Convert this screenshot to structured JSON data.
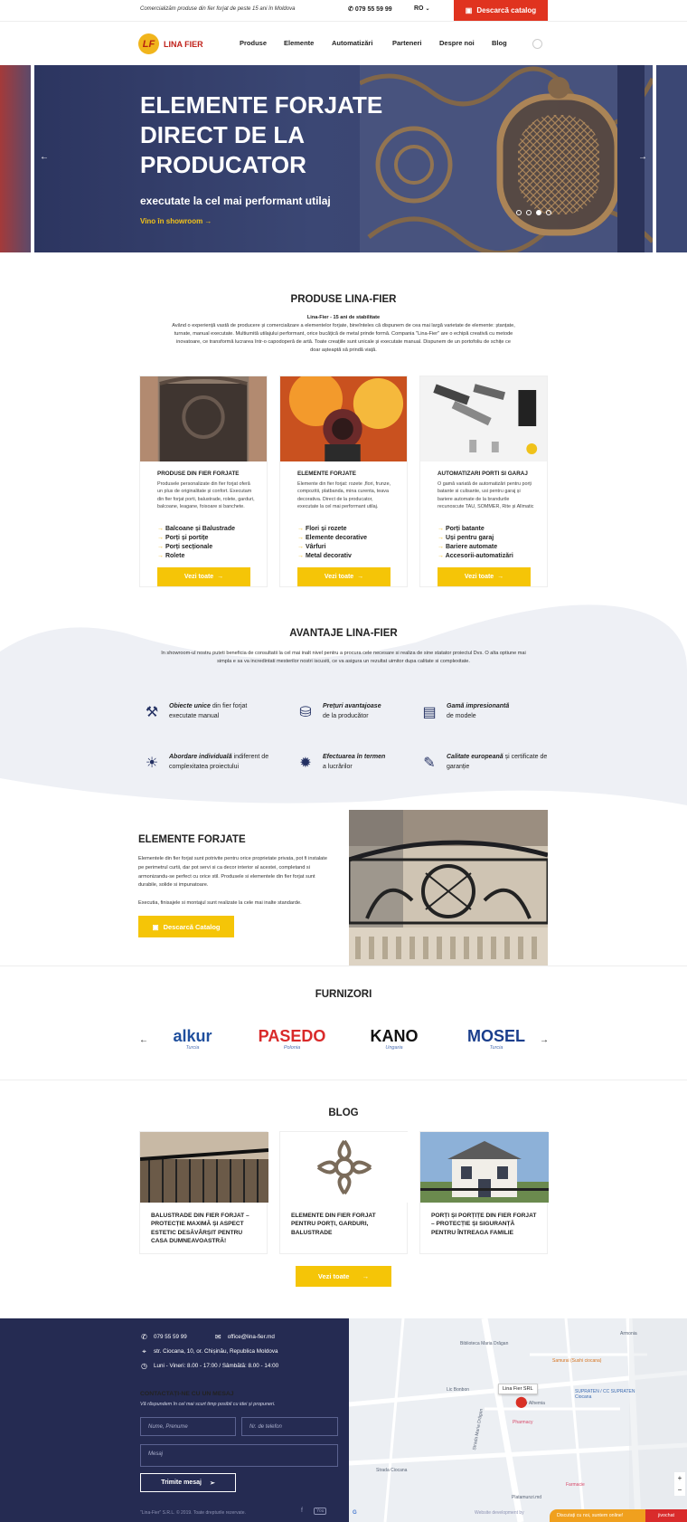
{
  "topbar": {
    "tagline": "Comercializăm produse din fier forjat de peste 15 ani în Moldova",
    "phone": "079 55 59 99",
    "lang": "RO",
    "catalog_label": "Descarcă catalog"
  },
  "header": {
    "logo_mark": "LF",
    "logo_text": "LINA FIER",
    "nav": [
      "Produse",
      "Elemente",
      "Automatizări",
      "Parteneri",
      "Despre noi",
      "Blog"
    ]
  },
  "hero": {
    "title": "ELEMENTE FORJATE DIRECT DE LA PRODUCATOR",
    "subtitle": "executate la cel mai performant utilaj",
    "cta": "Vino în showroom",
    "slides": 4,
    "active_slide": 3
  },
  "products": {
    "title": "PRODUSE LINA-FIER",
    "subtitle": "Lina-Fier - 15 ani de stabilitate",
    "intro": "Având o experiență vastă de producere și comercializare a elementelor forjate, bineînteles că dispunem de cea mai largă varietate de elemente: ștanțate, turnate, manual executate. Multiumită utilajului performant, orice bucățică de metal prinde formă. Compania \"Lina-Fier\" are o echipă creativă cu metode inovatoare, ce transformă lucrarea într-o capodoperă de artă. Toate creațiile sunt unicale și executate manual. Dispunem de un portofoliu de schițe ce doar așteaptă să prindă viață.",
    "cards": [
      {
        "title": "PRODUSE DIN FIER FORJATE",
        "desc": "Produsele personalizate din fier forjat oferă un plus de originalitate și confort. Executam din fier forjat porti, balustrade, rolete, garduri, balcoane, leagane, foisoare si banchete.",
        "items": [
          "Balcoane și Balustrade",
          "Porți și portițe",
          "Porți secționale",
          "Rolete"
        ],
        "button": "Vezi toate"
      },
      {
        "title": "ELEMENTE FORJATE",
        "desc": "Elemente din fier forjat: rozete ,flori, frunze, compozitii, platbanda, mina curenta, teava decorativa. Direct de la producator, executate la cel mai performant utilaj.",
        "items": [
          "Flori și rozete",
          "Elemente decorative",
          "Vârfuri",
          "Metal decorativ"
        ],
        "button": "Vezi toate"
      },
      {
        "title": "AUTOMATIZARI PORTI SI GARAJ",
        "desc": "O gamă variată de automatizări pentru porți batante si culisante, usi pentru garaj și bariere automate de la brandurile recunoscute TAU, SOMMER, Rite și Allmatic",
        "items": [
          "Porți batante",
          "Uși pentru garaj",
          "Bariere automate",
          "Accesorii-automatizări"
        ],
        "button": "Vezi toate"
      }
    ]
  },
  "advantages": {
    "title": "AVANTAJE LINA-FIER",
    "intro": "In showroom-ul nostru puteti beneficia de consultatii la cel mai inalt nivel pentru a procura cele necesare si realiza de sine statator proiectul Dvs. O alta optiune mai simpla e sa va incredintati mesterilor nostri iscusiti, ce va asigura un rezultat uimitor dupa calitate si complexitate.",
    "items": [
      {
        "bold": "Obiecte unice",
        "rest": " din fier forjat executate manual"
      },
      {
        "bold": "Prețuri avantajoase",
        "rest": " de la producător"
      },
      {
        "bold": "Gamă impresionantă",
        "rest": " de modele"
      },
      {
        "bold": "Abordare individuală",
        "rest": " indiferent de complexitatea proiectului"
      },
      {
        "bold": "Efectuarea în termen",
        "rest": " a lucrărilor"
      },
      {
        "bold": "Calitate europeană",
        "rest": " și certificate de garanție"
      }
    ]
  },
  "elemente": {
    "title": "ELEMENTE FORJATE",
    "p1": "Elementele din fier forjat sunt potrivite pentru orice proprietate privata, pot fi instalate pe perimetrul curtii, dar pot servi si ca decor interior al acestei, completand si armonizandu-se perfect cu orice stil. Produsele si elementele din fier forjat sunt durabile, solide si impunatoare.",
    "p2": "Executia, finisajele si montajul sunt realizate la cele mai inalte standarde.",
    "button": "Descarcă Catalog"
  },
  "suppliers": {
    "title": "FURNIZORI",
    "items": [
      {
        "name": "alkur",
        "country": "Turcia"
      },
      {
        "name": "PASEDO",
        "country": "Polonia"
      },
      {
        "name": "KANO",
        "country": "Ungaria"
      },
      {
        "name": "MOSEL",
        "country": "Turcia"
      }
    ]
  },
  "blog": {
    "title": "BLOG",
    "posts": [
      "BALUSTRADE DIN FIER FORJAT – PROTECȚIE MAXIMĂ ȘI ASPECT ESTETIC DESĂVÂRȘIT PENTRU CASA DUMNEAVOASTRĂ!",
      "ELEMENTE DIN FIER FORJAT PENTRU PORȚI, GARDURI, BALUSTRADE",
      "PORȚI ȘI PORȚIȚE DIN FIER FORJAT – PROTECȚIE ȘI SIGURANȚĂ PENTRU ÎNTREAGA FAMILIE"
    ],
    "button": "Vezi toate"
  },
  "footer": {
    "phone": "079 55 59 99",
    "email": "office@lina-fier.md",
    "address": "str. Ciocana, 10, or. Chișinău, Republica Moldova",
    "hours": "Luni - Vineri: 8.00 - 17:00 / Sâmbătă: 8.00 - 14:00",
    "form_title": "CONTACTAȚI-NE CU UN MESAJ",
    "form_sub": "Vă răspundem în cel mai scurt timp posibil cu idei și propuneri.",
    "name_ph": "Nume, Prenume",
    "phone_ph": "Nr. de telefon",
    "msg_ph": "Mesaj",
    "send": "Trimite mesaj",
    "copyright": "\"Lina-Fier\" S.R.L. © 2019. Toate drepturile rezervate.",
    "dev": "Website development by"
  },
  "map": {
    "pin": "Lina Fier SRL",
    "labels": [
      "Biblioteca Maria Drăgan",
      "Armonia",
      "Samurai (Sushi ciocana)",
      "Lic Bonbon",
      "Bar Alhemia",
      "SUPRATEN / CC SUPRATEN Ciocana",
      "Pharmacy",
      "Farmacie",
      "Platamunzi.md",
      "Strada Maria Drăgan",
      "Strada Ciocana"
    ]
  },
  "chat": {
    "text": "Discutați cu noi, suntem online!",
    "brand": "jivochat"
  }
}
